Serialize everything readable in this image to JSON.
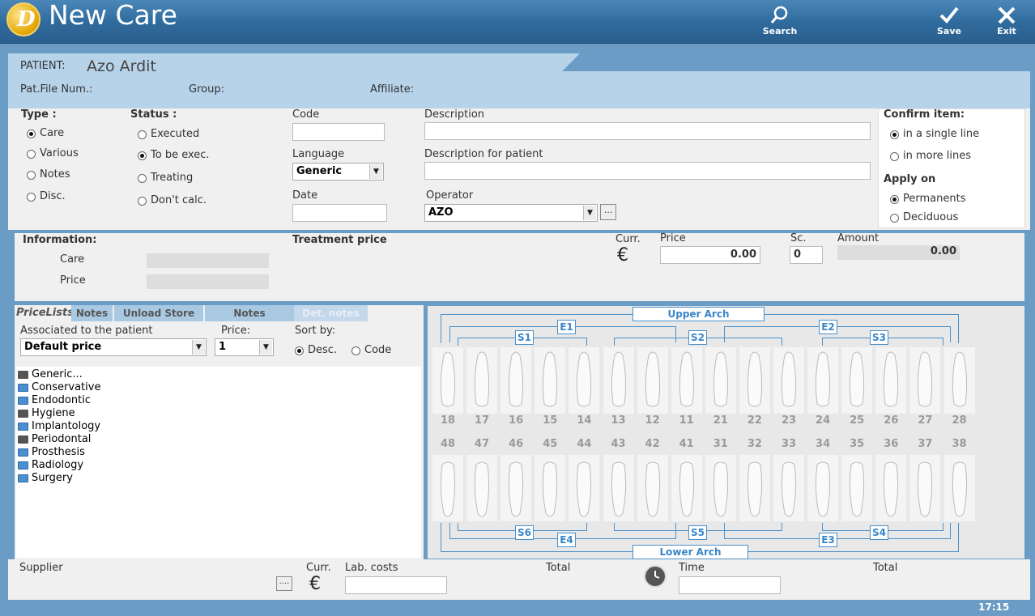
{
  "window": {
    "title": "New Care",
    "logo_letter": "D",
    "clock": "17:15"
  },
  "toolbar": {
    "search": "Search",
    "save": "Save",
    "exit": "Exit"
  },
  "patient": {
    "label": "PATIENT:",
    "name": "Azo Ardit",
    "file_num": "Pat.File Num.:",
    "group": "Group:",
    "affiliate": "Affiliate:"
  },
  "type": {
    "label": "Type :",
    "options": [
      "Care",
      "Various",
      "Notes",
      "Disc."
    ],
    "selected": "Care"
  },
  "status": {
    "label": "Status :",
    "options": [
      "Executed",
      "To be exec.",
      "Treating",
      "Don't calc."
    ],
    "selected": "To be exec."
  },
  "code": {
    "label": "Code",
    "value": ""
  },
  "language": {
    "label": "Language",
    "value": "Generic"
  },
  "date": {
    "label": "Date",
    "value": ""
  },
  "description": {
    "label": "Description",
    "value": ""
  },
  "description_patient": {
    "label": "Description for patient",
    "value": ""
  },
  "operator": {
    "label": "Operator",
    "value": "AZO",
    "more": "..."
  },
  "confirm": {
    "label": "Confirm item:",
    "options": [
      "in a single line",
      "in more lines"
    ],
    "selected": "in a single line"
  },
  "apply": {
    "label": "Apply on",
    "options": [
      "Permanents",
      "Deciduous"
    ],
    "selected": "Permanents"
  },
  "information": {
    "label": "Information:",
    "care": "Care",
    "price": "Price"
  },
  "treatment": {
    "label": "Treatment price",
    "curr_label": "Curr.",
    "curr_symbol": "€",
    "price_label": "Price",
    "price": "0.00",
    "sc_label": "Sc.",
    "sc": "0",
    "amount_label": "Amount",
    "amount": "0.00"
  },
  "tabs": [
    "PriceLists",
    "Notes",
    "Unload Store",
    "Notes",
    "Det. notes"
  ],
  "pricelist": {
    "assoc_label": "Associated to the patient",
    "assoc_value": "Default price",
    "price_label": "Price:",
    "price_value": "1",
    "sort_label": "Sort by:",
    "sort_options": [
      "Desc.",
      "Code"
    ],
    "sort_selected": "Desc."
  },
  "tree": [
    {
      "label": "Generic...",
      "kind": "folder"
    },
    {
      "label": "Conservative",
      "kind": "colored"
    },
    {
      "label": "Endodontic",
      "kind": "colored"
    },
    {
      "label": "Hygiene",
      "kind": "folder"
    },
    {
      "label": "Implantology",
      "kind": "colored"
    },
    {
      "label": "Periodontal",
      "kind": "folder"
    },
    {
      "label": "Prosthesis",
      "kind": "colored"
    },
    {
      "label": "Radiology",
      "kind": "colored"
    },
    {
      "label": "Surgery",
      "kind": "colored"
    }
  ],
  "chart": {
    "upper_arch": "Upper Arch",
    "lower_arch": "Lower Arch",
    "sextants": {
      "S1": "S1",
      "S2": "S2",
      "S3": "S3",
      "S4": "S4",
      "S5": "S5",
      "S6": "S6",
      "E1": "E1",
      "E2": "E2",
      "E3": "E3",
      "E4": "E4"
    },
    "upper": [
      "18",
      "17",
      "16",
      "15",
      "14",
      "13",
      "12",
      "11",
      "21",
      "22",
      "23",
      "24",
      "25",
      "26",
      "27",
      "28"
    ],
    "lower": [
      "48",
      "47",
      "46",
      "45",
      "44",
      "43",
      "42",
      "41",
      "31",
      "32",
      "33",
      "34",
      "35",
      "36",
      "37",
      "38"
    ]
  },
  "footer": {
    "supplier": "Supplier",
    "more": "....",
    "curr_label": "Curr.",
    "curr_symbol": "€",
    "lab_costs": "Lab. costs",
    "total1": "Total",
    "time": "Time",
    "total2": "Total"
  }
}
